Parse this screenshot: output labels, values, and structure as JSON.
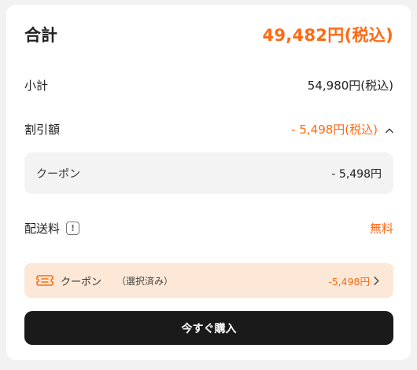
{
  "summary": {
    "total_label": "合計",
    "total_value": "49,482円(税込)",
    "subtotal_label": "小計",
    "subtotal_value": "54,980円(税込)",
    "discount_label": "割引額",
    "discount_value": "- 5,498円(税込)",
    "coupon_label": "クーポン",
    "coupon_amount": "- 5,498円",
    "shipping_label": "配送料",
    "shipping_info_icon": "!",
    "shipping_value": "無料"
  },
  "coupon_select": {
    "label": "クーポン",
    "status": "（選択済み）",
    "amount": "-5,498円",
    "icon": "ticket-icon"
  },
  "buy_button": {
    "label": "今すぐ購入"
  },
  "colors": {
    "accent": "#ff6a13",
    "coupon_bg": "#fde8d8",
    "button_bg": "#1a1a1a"
  }
}
